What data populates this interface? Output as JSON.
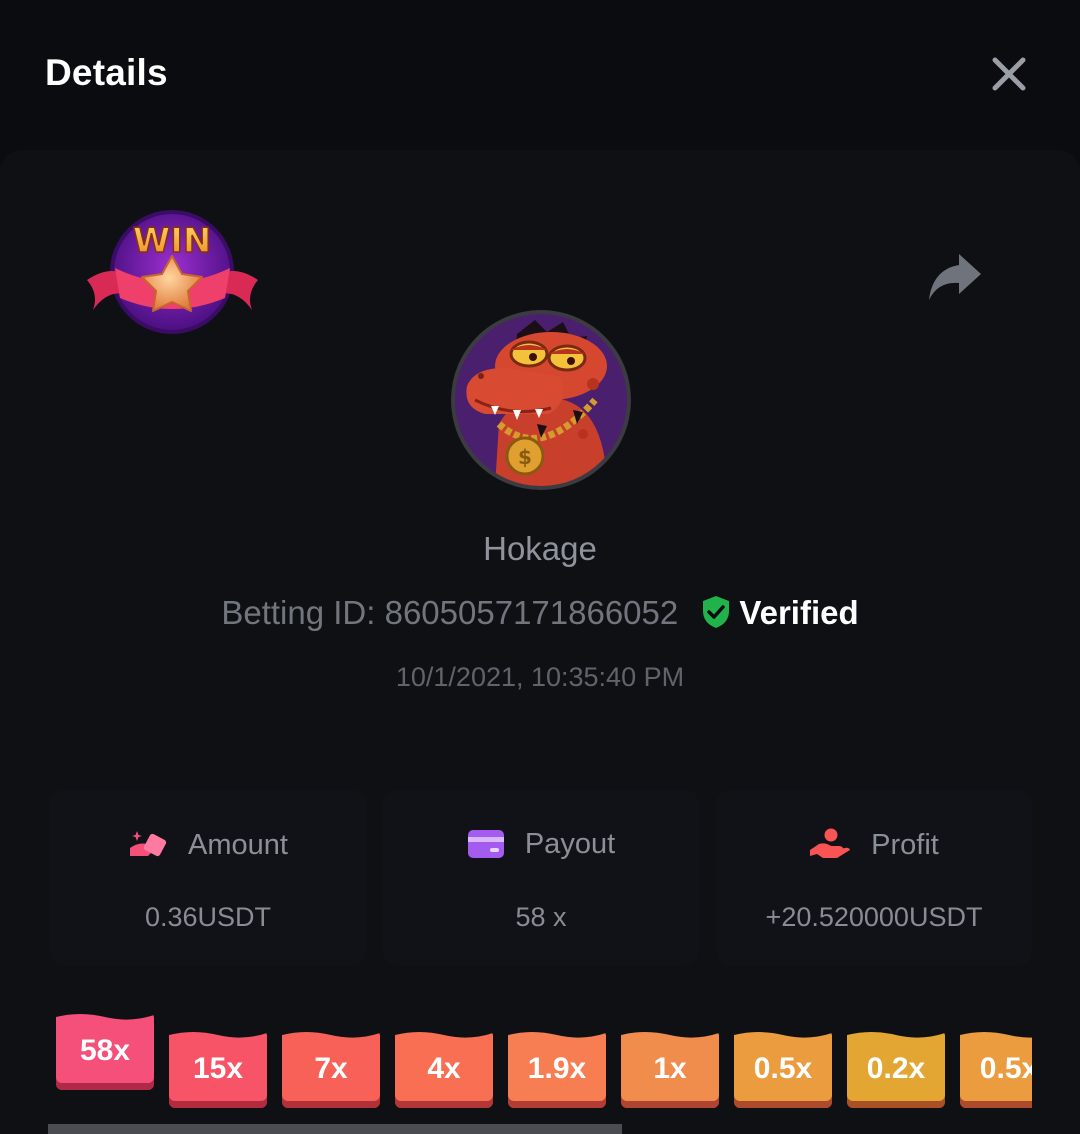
{
  "header": {
    "title": "Details"
  },
  "badge": {
    "text": "WIN"
  },
  "player": {
    "name": "Hokage",
    "betting_id_label": "Betting ID:",
    "betting_id": "8605057171866052",
    "verified_label": "Verified",
    "timestamp": "10/1/2021, 10:35:40 PM"
  },
  "stats": [
    {
      "label": "Amount",
      "value": "0.36USDT",
      "icon": "amount-icon"
    },
    {
      "label": "Payout",
      "value": "58 x",
      "icon": "card-icon"
    },
    {
      "label": "Profit",
      "value": "+20.520000USDT",
      "icon": "profit-hand-icon"
    }
  ],
  "multipliers": [
    {
      "label": "58x",
      "color": "#f4507a",
      "active": true
    },
    {
      "label": "15x",
      "color": "#f85468"
    },
    {
      "label": "7x",
      "color": "#f86158"
    },
    {
      "label": "4x",
      "color": "#f86f54"
    },
    {
      "label": "1.9x",
      "color": "#f77d52"
    },
    {
      "label": "1x",
      "color": "#f08c4c"
    },
    {
      "label": "0.5x",
      "color": "#eb9c3f"
    },
    {
      "label": "0.2x",
      "color": "#e4a633"
    },
    {
      "label": "0.5x",
      "color": "#eb9c3f"
    }
  ],
  "colors": {
    "background": "#0b0c0f",
    "verified_green": "#22b24c"
  }
}
